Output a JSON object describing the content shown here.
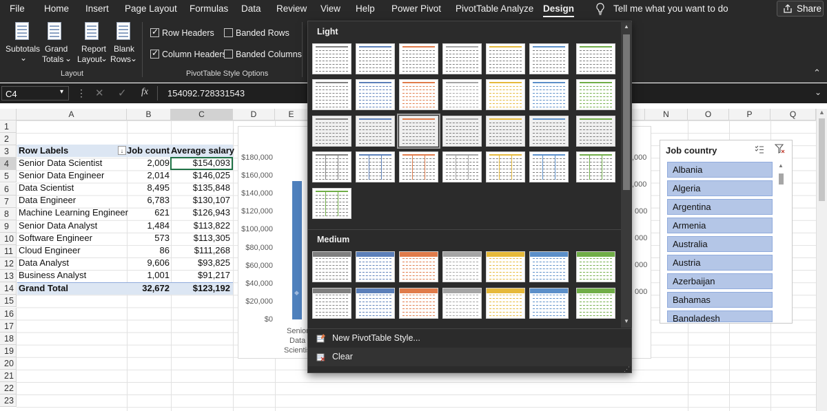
{
  "menu": {
    "items": [
      "File",
      "Home",
      "Insert",
      "Page Layout",
      "Formulas",
      "Data",
      "Review",
      "View",
      "Help",
      "Power Pivot",
      "PivotTable Analyze",
      "Design"
    ],
    "active": "Design",
    "tell_me": "Tell me what you want to do",
    "share": "Share"
  },
  "ribbon": {
    "subtotals": "Subtotals",
    "grand_totals_1": "Grand",
    "grand_totals_2": "Totals",
    "report_layout_1": "Report",
    "report_layout_2": "Layout",
    "blank_rows_1": "Blank",
    "blank_rows_2": "Rows",
    "layout_group": "Layout",
    "row_headers": "Row Headers",
    "column_headers": "Column Headers",
    "banded_rows": "Banded Rows",
    "banded_columns": "Banded Columns",
    "options_group": "PivotTable Style Options"
  },
  "formula_bar": {
    "name_box": "C4",
    "fx": "fx",
    "value": "154092.728331543"
  },
  "columns": [
    "A",
    "B",
    "C",
    "D",
    "E",
    "",
    "",
    "",
    "",
    "",
    "",
    "N",
    "O",
    "P",
    "Q"
  ],
  "rows": [
    "1",
    "2",
    "3",
    "4",
    "5",
    "6",
    "7",
    "8",
    "9",
    "10",
    "11",
    "12",
    "13",
    "14",
    "15",
    "16",
    "17",
    "18",
    "19",
    "20",
    "21",
    "22",
    "23"
  ],
  "pivot": {
    "headers": {
      "labels": "Row Labels",
      "count": "Job count",
      "salary": "Average salary"
    },
    "rows": [
      {
        "label": "Senior Data Scientist",
        "count": "2,009",
        "salary": "$154,093"
      },
      {
        "label": "Senior Data Engineer",
        "count": "2,014",
        "salary": "$146,025"
      },
      {
        "label": "Data Scientist",
        "count": "8,495",
        "salary": "$135,848"
      },
      {
        "label": "Data Engineer",
        "count": "6,783",
        "salary": "$130,107"
      },
      {
        "label": "Machine Learning Engineer",
        "count": "621",
        "salary": "$126,943"
      },
      {
        "label": "Senior Data Analyst",
        "count": "1,484",
        "salary": "$113,822"
      },
      {
        "label": "Software Engineer",
        "count": "573",
        "salary": "$113,305"
      },
      {
        "label": "Cloud Engineer",
        "count": "86",
        "salary": "$111,268"
      },
      {
        "label": "Data Analyst",
        "count": "9,606",
        "salary": "$93,825"
      },
      {
        "label": "Business Analyst",
        "count": "1,001",
        "salary": "$91,217"
      }
    ],
    "total": {
      "label": "Grand Total",
      "count": "32,672",
      "salary": "$123,192"
    }
  },
  "chart": {
    "y_ticks": [
      "$180,000",
      "$160,000",
      "$140,000",
      "$120,000",
      "$100,000",
      "$80,000",
      "$60,000",
      "$40,000",
      "$20,000",
      "$0"
    ],
    "right_ticks": ",000",
    "right_ticks_alt": "000",
    "x_label_1": "Senior",
    "x_label_2": "Data",
    "x_label_3": "Scientis",
    "bar_value": 154093,
    "bar_color": "#4f81bd"
  },
  "slicer": {
    "title": "Job country",
    "items": [
      "Albania",
      "Algeria",
      "Argentina",
      "Armenia",
      "Australia",
      "Austria",
      "Azerbaijan",
      "Bahamas",
      "Bangladesh"
    ]
  },
  "gallery": {
    "light_title": "Light",
    "medium_title": "Medium",
    "new_style": "New PivotTable Style...",
    "clear": "Clear",
    "palette": [
      "#7f7f7f",
      "#5b7fb9",
      "#5b7fb9",
      "#e07b4a",
      "#a5a5a5",
      "#e6b93a",
      "#5b8fc9",
      "#70ad47"
    ]
  }
}
